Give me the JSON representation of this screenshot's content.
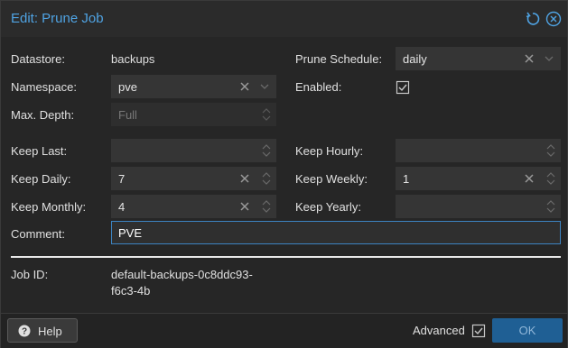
{
  "dialog": {
    "title": "Edit: Prune Job"
  },
  "fields": {
    "datastore": {
      "label": "Datastore:",
      "value": "backups"
    },
    "prune_schedule": {
      "label": "Prune Schedule:",
      "value": "daily"
    },
    "namespace": {
      "label": "Namespace:",
      "value": "pve"
    },
    "enabled": {
      "label": "Enabled:",
      "checked": true
    },
    "max_depth": {
      "label": "Max. Depth:",
      "placeholder": "Full"
    },
    "keep_last": {
      "label": "Keep Last:",
      "value": ""
    },
    "keep_hourly": {
      "label": "Keep Hourly:",
      "value": ""
    },
    "keep_daily": {
      "label": "Keep Daily:",
      "value": "7"
    },
    "keep_weekly": {
      "label": "Keep Weekly:",
      "value": "1"
    },
    "keep_monthly": {
      "label": "Keep Monthly:",
      "value": "4"
    },
    "keep_yearly": {
      "label": "Keep Yearly:",
      "value": ""
    },
    "comment": {
      "label": "Comment:",
      "value": "PVE"
    },
    "job_id": {
      "label": "Job ID:",
      "value_line1": "default-backups-0c8ddc93-",
      "value_line2": "f6c3-4b"
    }
  },
  "footer": {
    "help_label": "Help",
    "advanced_label": "Advanced",
    "advanced_checked": true,
    "ok_label": "OK"
  },
  "colors": {
    "accent": "#4fa3e3",
    "ok_button": "#1f5f94",
    "focus_border": "#3d84c2"
  }
}
